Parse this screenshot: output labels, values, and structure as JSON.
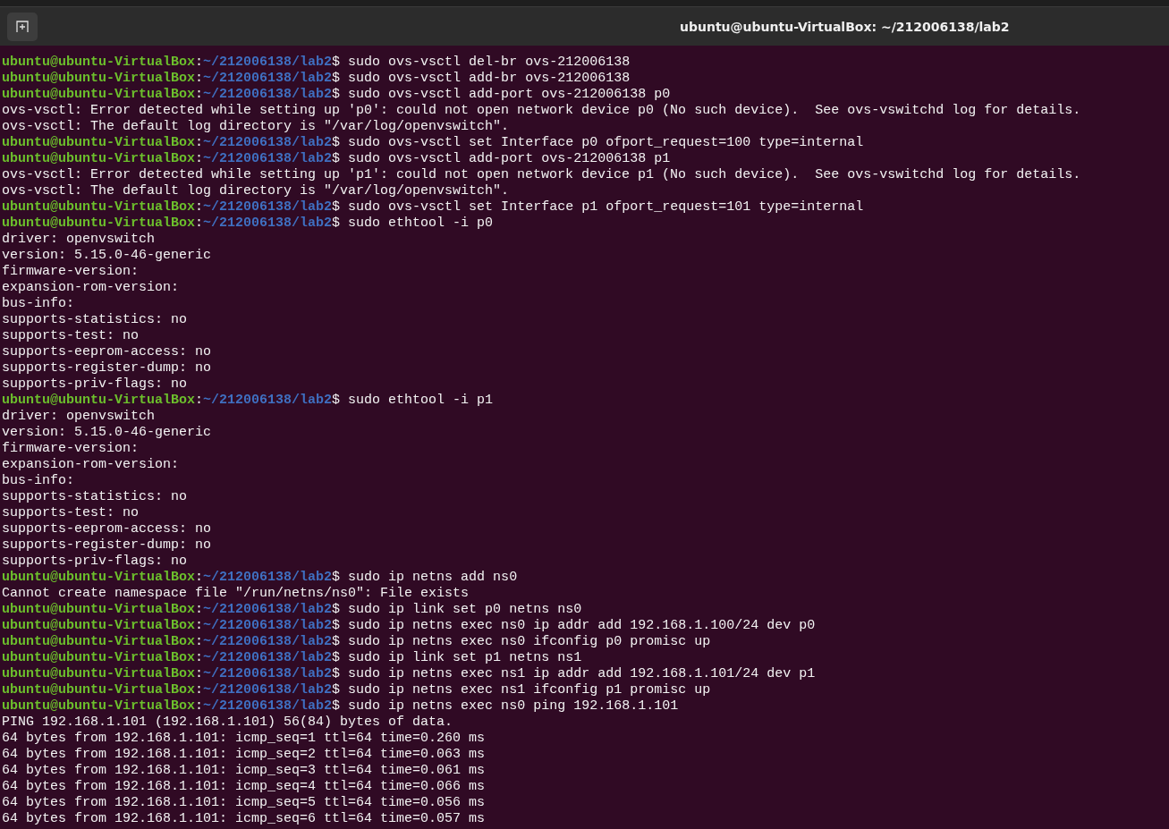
{
  "window": {
    "title": "ubuntu@ubuntu-VirtualBox: ~/212006138/lab2"
  },
  "lines": [
    {
      "kind": "prompt",
      "user": "ubuntu@ubuntu-VirtualBox",
      "separator": ":",
      "path": "~/212006138/lab2",
      "command": "$ sudo ovs-vsctl del-br ovs-212006138"
    },
    {
      "kind": "prompt",
      "user": "ubuntu@ubuntu-VirtualBox",
      "separator": ":",
      "path": "~/212006138/lab2",
      "command": "$ sudo ovs-vsctl add-br ovs-212006138"
    },
    {
      "kind": "prompt",
      "user": "ubuntu@ubuntu-VirtualBox",
      "separator": ":",
      "path": "~/212006138/lab2",
      "command": "$ sudo ovs-vsctl add-port ovs-212006138 p0"
    },
    {
      "kind": "output",
      "text": "ovs-vsctl: Error detected while setting up 'p0': could not open network device p0 (No such device).  See ovs-vswitchd log for details."
    },
    {
      "kind": "output",
      "text": "ovs-vsctl: The default log directory is \"/var/log/openvswitch\"."
    },
    {
      "kind": "prompt",
      "user": "ubuntu@ubuntu-VirtualBox",
      "separator": ":",
      "path": "~/212006138/lab2",
      "command": "$ sudo ovs-vsctl set Interface p0 ofport_request=100 type=internal"
    },
    {
      "kind": "prompt",
      "user": "ubuntu@ubuntu-VirtualBox",
      "separator": ":",
      "path": "~/212006138/lab2",
      "command": "$ sudo ovs-vsctl add-port ovs-212006138 p1"
    },
    {
      "kind": "output",
      "text": "ovs-vsctl: Error detected while setting up 'p1': could not open network device p1 (No such device).  See ovs-vswitchd log for details."
    },
    {
      "kind": "output",
      "text": "ovs-vsctl: The default log directory is \"/var/log/openvswitch\"."
    },
    {
      "kind": "prompt",
      "user": "ubuntu@ubuntu-VirtualBox",
      "separator": ":",
      "path": "~/212006138/lab2",
      "command": "$ sudo ovs-vsctl set Interface p1 ofport_request=101 type=internal"
    },
    {
      "kind": "prompt",
      "user": "ubuntu@ubuntu-VirtualBox",
      "separator": ":",
      "path": "~/212006138/lab2",
      "command": "$ sudo ethtool -i p0"
    },
    {
      "kind": "output",
      "text": "driver: openvswitch"
    },
    {
      "kind": "output",
      "text": "version: 5.15.0-46-generic"
    },
    {
      "kind": "output",
      "text": "firmware-version:"
    },
    {
      "kind": "output",
      "text": "expansion-rom-version:"
    },
    {
      "kind": "output",
      "text": "bus-info:"
    },
    {
      "kind": "output",
      "text": "supports-statistics: no"
    },
    {
      "kind": "output",
      "text": "supports-test: no"
    },
    {
      "kind": "output",
      "text": "supports-eeprom-access: no"
    },
    {
      "kind": "output",
      "text": "supports-register-dump: no"
    },
    {
      "kind": "output",
      "text": "supports-priv-flags: no"
    },
    {
      "kind": "prompt",
      "user": "ubuntu@ubuntu-VirtualBox",
      "separator": ":",
      "path": "~/212006138/lab2",
      "command": "$ sudo ethtool -i p1"
    },
    {
      "kind": "output",
      "text": "driver: openvswitch"
    },
    {
      "kind": "output",
      "text": "version: 5.15.0-46-generic"
    },
    {
      "kind": "output",
      "text": "firmware-version:"
    },
    {
      "kind": "output",
      "text": "expansion-rom-version:"
    },
    {
      "kind": "output",
      "text": "bus-info:"
    },
    {
      "kind": "output",
      "text": "supports-statistics: no"
    },
    {
      "kind": "output",
      "text": "supports-test: no"
    },
    {
      "kind": "output",
      "text": "supports-eeprom-access: no"
    },
    {
      "kind": "output",
      "text": "supports-register-dump: no"
    },
    {
      "kind": "output",
      "text": "supports-priv-flags: no"
    },
    {
      "kind": "prompt",
      "user": "ubuntu@ubuntu-VirtualBox",
      "separator": ":",
      "path": "~/212006138/lab2",
      "command": "$ sudo ip netns add ns0"
    },
    {
      "kind": "output",
      "text": "Cannot create namespace file \"/run/netns/ns0\": File exists"
    },
    {
      "kind": "prompt",
      "user": "ubuntu@ubuntu-VirtualBox",
      "separator": ":",
      "path": "~/212006138/lab2",
      "command": "$ sudo ip link set p0 netns ns0"
    },
    {
      "kind": "prompt",
      "user": "ubuntu@ubuntu-VirtualBox",
      "separator": ":",
      "path": "~/212006138/lab2",
      "command": "$ sudo ip netns exec ns0 ip addr add 192.168.1.100/24 dev p0"
    },
    {
      "kind": "prompt",
      "user": "ubuntu@ubuntu-VirtualBox",
      "separator": ":",
      "path": "~/212006138/lab2",
      "command": "$ sudo ip netns exec ns0 ifconfig p0 promisc up"
    },
    {
      "kind": "prompt",
      "user": "ubuntu@ubuntu-VirtualBox",
      "separator": ":",
      "path": "~/212006138/lab2",
      "command": "$ sudo ip link set p1 netns ns1"
    },
    {
      "kind": "prompt",
      "user": "ubuntu@ubuntu-VirtualBox",
      "separator": ":",
      "path": "~/212006138/lab2",
      "command": "$ sudo ip netns exec ns1 ip addr add 192.168.1.101/24 dev p1"
    },
    {
      "kind": "prompt",
      "user": "ubuntu@ubuntu-VirtualBox",
      "separator": ":",
      "path": "~/212006138/lab2",
      "command": "$ sudo ip netns exec ns1 ifconfig p1 promisc up"
    },
    {
      "kind": "prompt",
      "user": "ubuntu@ubuntu-VirtualBox",
      "separator": ":",
      "path": "~/212006138/lab2",
      "command": "$ sudo ip netns exec ns0 ping 192.168.1.101"
    },
    {
      "kind": "output",
      "text": "PING 192.168.1.101 (192.168.1.101) 56(84) bytes of data."
    },
    {
      "kind": "output",
      "text": "64 bytes from 192.168.1.101: icmp_seq=1 ttl=64 time=0.260 ms"
    },
    {
      "kind": "output",
      "text": "64 bytes from 192.168.1.101: icmp_seq=2 ttl=64 time=0.063 ms"
    },
    {
      "kind": "output",
      "text": "64 bytes from 192.168.1.101: icmp_seq=3 ttl=64 time=0.061 ms"
    },
    {
      "kind": "output",
      "text": "64 bytes from 192.168.1.101: icmp_seq=4 ttl=64 time=0.066 ms"
    },
    {
      "kind": "output",
      "text": "64 bytes from 192.168.1.101: icmp_seq=5 ttl=64 time=0.056 ms"
    },
    {
      "kind": "output",
      "text": "64 bytes from 192.168.1.101: icmp_seq=6 ttl=64 time=0.057 ms"
    }
  ]
}
